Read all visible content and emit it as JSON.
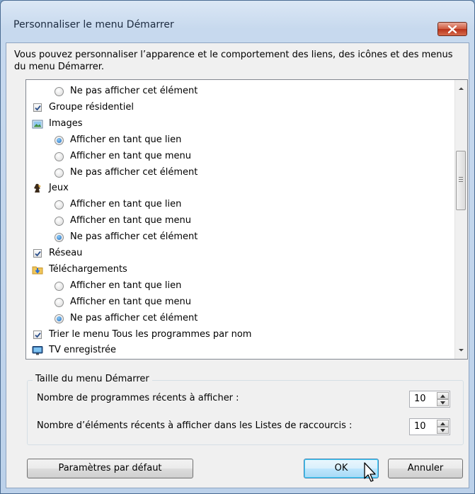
{
  "window": {
    "title": "Personnaliser le menu Démarrer"
  },
  "intro_text": "Vous pouvez personnaliser l’apparence et le comportement des liens, des icônes et des menus du menu Démarrer.",
  "options_list": {
    "rows": [
      {
        "kind": "radio",
        "label": "Ne pas afficher cet élément",
        "checked": false
      },
      {
        "kind": "checkbox",
        "label": "Groupe résidentiel",
        "checked": true
      },
      {
        "kind": "heading",
        "icon": "pictures-icon",
        "label": "Images"
      },
      {
        "kind": "radio",
        "label": "Afficher en tant que lien",
        "checked": true
      },
      {
        "kind": "radio",
        "label": "Afficher en tant que menu",
        "checked": false
      },
      {
        "kind": "radio",
        "label": "Ne pas afficher cet élément",
        "checked": false
      },
      {
        "kind": "heading",
        "icon": "games-icon",
        "label": "Jeux"
      },
      {
        "kind": "radio",
        "label": "Afficher en tant que lien",
        "checked": false
      },
      {
        "kind": "radio",
        "label": "Afficher en tant que menu",
        "checked": false
      },
      {
        "kind": "radio",
        "label": "Ne pas afficher cet élément",
        "checked": true
      },
      {
        "kind": "checkbox",
        "label": "Réseau",
        "checked": true
      },
      {
        "kind": "heading",
        "icon": "downloads-folder-icon",
        "label": "Téléchargements"
      },
      {
        "kind": "radio",
        "label": "Afficher en tant que lien",
        "checked": false
      },
      {
        "kind": "radio",
        "label": "Afficher en tant que menu",
        "checked": false
      },
      {
        "kind": "radio",
        "label": "Ne pas afficher cet élément",
        "checked": true
      },
      {
        "kind": "checkbox",
        "label": "Trier le menu Tous les programmes par nom",
        "checked": true
      },
      {
        "kind": "heading",
        "icon": "recorded-tv-icon",
        "label": "TV enregistrée"
      }
    ]
  },
  "start_menu_size": {
    "group_title": "Taille du menu Démarrer",
    "recent_programs_label": "Nombre de programmes récents à afficher :",
    "recent_programs_value": "10",
    "jump_list_items_label": "Nombre d’éléments récents à afficher dans les Listes de raccourcis :",
    "jump_list_items_value": "10"
  },
  "buttons": {
    "defaults": "Paramètres par défaut",
    "ok": "OK",
    "cancel": "Annuler"
  },
  "colors": {
    "accent": "#3c7fb1",
    "close_red": "#c7432a"
  }
}
